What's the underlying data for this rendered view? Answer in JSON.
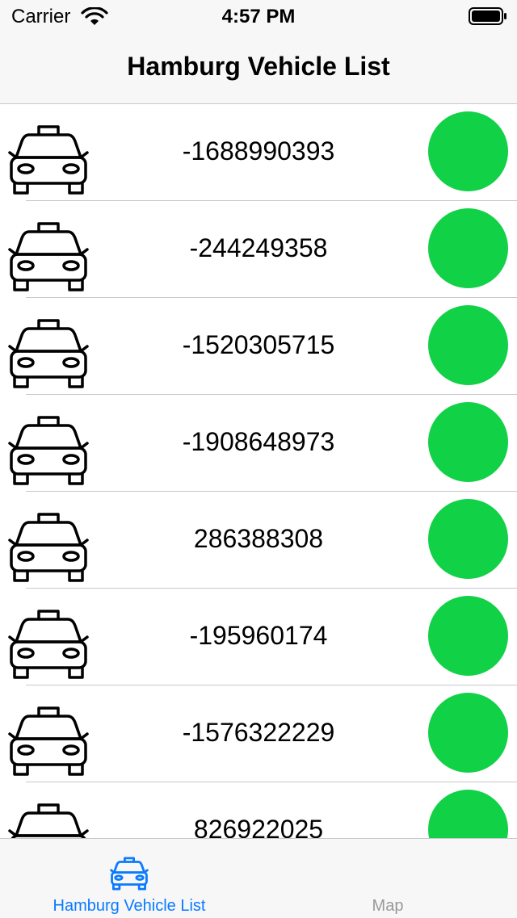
{
  "status_bar": {
    "carrier": "Carrier",
    "time": "4:57 PM"
  },
  "nav": {
    "title": "Hamburg Vehicle List"
  },
  "colors": {
    "status_active": "#11d147",
    "tab_active": "#0a7aff",
    "tab_inactive": "#999999"
  },
  "vehicles": [
    {
      "id": "-1688990393",
      "icon": "taxi-icon",
      "status_color": "#11d147"
    },
    {
      "id": "-244249358",
      "icon": "taxi-icon",
      "status_color": "#11d147"
    },
    {
      "id": "-1520305715",
      "icon": "taxi-icon",
      "status_color": "#11d147"
    },
    {
      "id": "-1908648973",
      "icon": "taxi-icon",
      "status_color": "#11d147"
    },
    {
      "id": "286388308",
      "icon": "taxi-icon",
      "status_color": "#11d147"
    },
    {
      "id": "-195960174",
      "icon": "taxi-icon",
      "status_color": "#11d147"
    },
    {
      "id": "-1576322229",
      "icon": "taxi-icon",
      "status_color": "#11d147"
    },
    {
      "id": "826922025",
      "icon": "taxi-icon",
      "status_color": "#11d147"
    }
  ],
  "tabs": [
    {
      "label": "Hamburg Vehicle List",
      "icon": "taxi-icon",
      "selected": true
    },
    {
      "label": "Map",
      "icon": "map-icon",
      "selected": false
    }
  ]
}
